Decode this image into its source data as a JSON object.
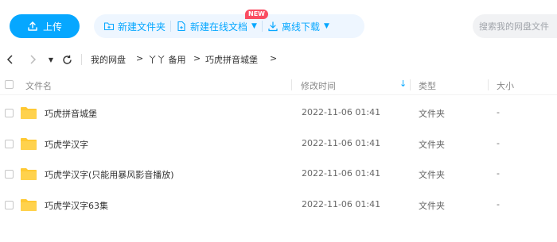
{
  "toolbar": {
    "upload_label": "上传",
    "new_folder_label": "新建文件夹",
    "new_doc_label": "新建在线文档",
    "new_badge": "NEW",
    "offline_label": "离线下载",
    "search_placeholder": "搜索我的网盘文件"
  },
  "breadcrumb": {
    "items": [
      "我的网盘",
      "丫丫 备用",
      "巧虎拼音城堡"
    ],
    "separator": ">"
  },
  "table": {
    "headers": {
      "name": "文件名",
      "modified": "修改时间",
      "type": "类型",
      "size": "大小"
    },
    "rows": [
      {
        "name": "巧虎拼音城堡",
        "modified": "2022-11-06 01:41",
        "type": "文件夹",
        "size": "-"
      },
      {
        "name": "巧虎学汉字",
        "modified": "2022-11-06 01:41",
        "type": "文件夹",
        "size": "-"
      },
      {
        "name": "巧虎学汉字(只能用暴风影音播放)",
        "modified": "2022-11-06 01:41",
        "type": "文件夹",
        "size": "-"
      },
      {
        "name": "巧虎学汉字63集",
        "modified": "2022-11-06 01:41",
        "type": "文件夹",
        "size": "-"
      }
    ]
  },
  "colors": {
    "accent": "#06a7ff",
    "accent_bg": "#eef6ff",
    "folder": "#ffd24d",
    "badge": "#fa4d62"
  }
}
